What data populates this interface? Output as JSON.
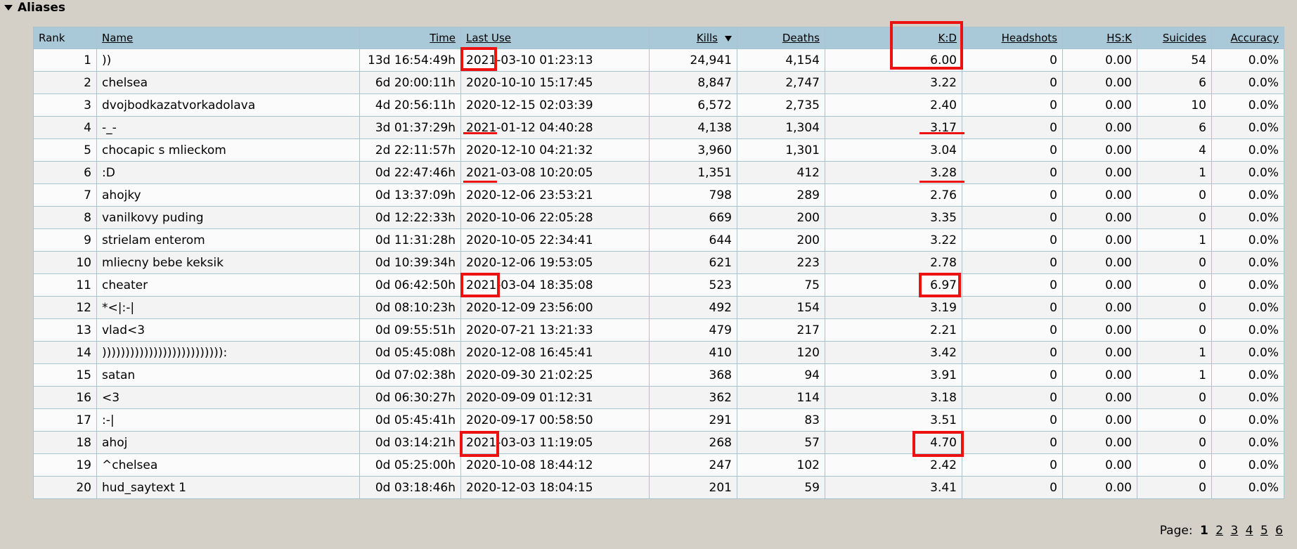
{
  "section": {
    "title": "Aliases"
  },
  "table": {
    "headers": {
      "rank": "Rank",
      "name": "Name",
      "time": "Time",
      "last_use": "Last Use",
      "kills": "Kills",
      "deaths": "Deaths",
      "kd": "K:D",
      "headshots": "Headshots",
      "hsk": "HS:K",
      "suicides": "Suicides",
      "accuracy": "Accuracy"
    },
    "rows": [
      {
        "rank": "1",
        "name": "))",
        "time": "13d 16:54:49h",
        "last_use": "2021-03-10 01:23:13",
        "kills": "24,941",
        "deaths": "4,154",
        "kd": "6.00",
        "headshots": "0",
        "hsk": "0.00",
        "suicides": "54",
        "accuracy": "0.0%"
      },
      {
        "rank": "2",
        "name": "chelsea",
        "time": "6d 20:00:11h",
        "last_use": "2020-10-10 15:17:45",
        "kills": "8,847",
        "deaths": "2,747",
        "kd": "3.22",
        "headshots": "0",
        "hsk": "0.00",
        "suicides": "6",
        "accuracy": "0.0%"
      },
      {
        "rank": "3",
        "name": "dvojbodkazatvorkadolava",
        "time": "4d 20:56:11h",
        "last_use": "2020-12-15 02:03:39",
        "kills": "6,572",
        "deaths": "2,735",
        "kd": "2.40",
        "headshots": "0",
        "hsk": "0.00",
        "suicides": "10",
        "accuracy": "0.0%"
      },
      {
        "rank": "4",
        "name": "-_-",
        "time": "3d 01:37:29h",
        "last_use": "2021-01-12 04:40:28",
        "kills": "4,138",
        "deaths": "1,304",
        "kd": "3.17",
        "headshots": "0",
        "hsk": "0.00",
        "suicides": "6",
        "accuracy": "0.0%"
      },
      {
        "rank": "5",
        "name": "chocapic s mlieckom",
        "time": "2d 22:11:57h",
        "last_use": "2020-12-10 04:21:32",
        "kills": "3,960",
        "deaths": "1,301",
        "kd": "3.04",
        "headshots": "0",
        "hsk": "0.00",
        "suicides": "4",
        "accuracy": "0.0%"
      },
      {
        "rank": "6",
        "name": ":D",
        "time": "0d 22:47:46h",
        "last_use": "2021-03-08 10:20:05",
        "kills": "1,351",
        "deaths": "412",
        "kd": "3.28",
        "headshots": "0",
        "hsk": "0.00",
        "suicides": "1",
        "accuracy": "0.0%"
      },
      {
        "rank": "7",
        "name": "ahojky",
        "time": "0d 13:37:09h",
        "last_use": "2020-12-06 23:53:21",
        "kills": "798",
        "deaths": "289",
        "kd": "2.76",
        "headshots": "0",
        "hsk": "0.00",
        "suicides": "0",
        "accuracy": "0.0%"
      },
      {
        "rank": "8",
        "name": "vanilkovy puding",
        "time": "0d 12:22:33h",
        "last_use": "2020-10-06 22:05:28",
        "kills": "669",
        "deaths": "200",
        "kd": "3.35",
        "headshots": "0",
        "hsk": "0.00",
        "suicides": "0",
        "accuracy": "0.0%"
      },
      {
        "rank": "9",
        "name": "strielam enterom",
        "time": "0d 11:31:28h",
        "last_use": "2020-10-05 22:34:41",
        "kills": "644",
        "deaths": "200",
        "kd": "3.22",
        "headshots": "0",
        "hsk": "0.00",
        "suicides": "1",
        "accuracy": "0.0%"
      },
      {
        "rank": "10",
        "name": "mliecny bebe keksik",
        "time": "0d 10:39:34h",
        "last_use": "2020-12-06 19:53:05",
        "kills": "621",
        "deaths": "223",
        "kd": "2.78",
        "headshots": "0",
        "hsk": "0.00",
        "suicides": "0",
        "accuracy": "0.0%"
      },
      {
        "rank": "11",
        "name": "cheater",
        "time": "0d 06:42:50h",
        "last_use": "2021-03-04 18:35:08",
        "kills": "523",
        "deaths": "75",
        "kd": "6.97",
        "headshots": "0",
        "hsk": "0.00",
        "suicides": "0",
        "accuracy": "0.0%"
      },
      {
        "rank": "12",
        "name": "*<|:-|",
        "time": "0d 08:10:23h",
        "last_use": "2020-12-09 23:56:00",
        "kills": "492",
        "deaths": "154",
        "kd": "3.19",
        "headshots": "0",
        "hsk": "0.00",
        "suicides": "0",
        "accuracy": "0.0%"
      },
      {
        "rank": "13",
        "name": "vlad<3",
        "time": "0d 09:55:51h",
        "last_use": "2020-07-21 13:21:33",
        "kills": "479",
        "deaths": "217",
        "kd": "2.21",
        "headshots": "0",
        "hsk": "0.00",
        "suicides": "0",
        "accuracy": "0.0%"
      },
      {
        "rank": "14",
        "name": ")))))))))))))))))))))))))):",
        "time": "0d 05:45:08h",
        "last_use": "2020-12-08 16:45:41",
        "kills": "410",
        "deaths": "120",
        "kd": "3.42",
        "headshots": "0",
        "hsk": "0.00",
        "suicides": "1",
        "accuracy": "0.0%"
      },
      {
        "rank": "15",
        "name": "satan",
        "time": "0d 07:02:38h",
        "last_use": "2020-09-30 21:02:25",
        "kills": "368",
        "deaths": "94",
        "kd": "3.91",
        "headshots": "0",
        "hsk": "0.00",
        "suicides": "1",
        "accuracy": "0.0%"
      },
      {
        "rank": "16",
        "name": "<3",
        "time": "0d 06:30:27h",
        "last_use": "2020-09-09 01:12:31",
        "kills": "362",
        "deaths": "114",
        "kd": "3.18",
        "headshots": "0",
        "hsk": "0.00",
        "suicides": "0",
        "accuracy": "0.0%"
      },
      {
        "rank": "17",
        "name": ":-|",
        "time": "0d 05:45:41h",
        "last_use": "2020-09-17 00:58:50",
        "kills": "291",
        "deaths": "83",
        "kd": "3.51",
        "headshots": "0",
        "hsk": "0.00",
        "suicides": "0",
        "accuracy": "0.0%"
      },
      {
        "rank": "18",
        "name": "ahoj",
        "time": "0d 03:14:21h",
        "last_use": "2021-03-03 11:19:05",
        "kills": "268",
        "deaths": "57",
        "kd": "4.70",
        "headshots": "0",
        "hsk": "0.00",
        "suicides": "0",
        "accuracy": "0.0%"
      },
      {
        "rank": "19",
        "name": "^chelsea",
        "time": "0d 05:25:00h",
        "last_use": "2020-10-08 18:44:12",
        "kills": "247",
        "deaths": "102",
        "kd": "2.42",
        "headshots": "0",
        "hsk": "0.00",
        "suicides": "0",
        "accuracy": "0.0%"
      },
      {
        "rank": "20",
        "name": "hud_saytext 1",
        "time": "0d 03:18:46h",
        "last_use": "2020-12-03 18:04:15",
        "kills": "201",
        "deaths": "59",
        "kd": "3.41",
        "headshots": "0",
        "hsk": "0.00",
        "suicides": "0",
        "accuracy": "0.0%"
      }
    ]
  },
  "pager": {
    "label": "Page:",
    "current": "1",
    "pages": [
      "2",
      "3",
      "4",
      "5",
      "6"
    ]
  },
  "colors": {
    "header_bg": "#a9c9d8",
    "page_bg": "#d4d0c8",
    "annotation": "#ee1111"
  }
}
